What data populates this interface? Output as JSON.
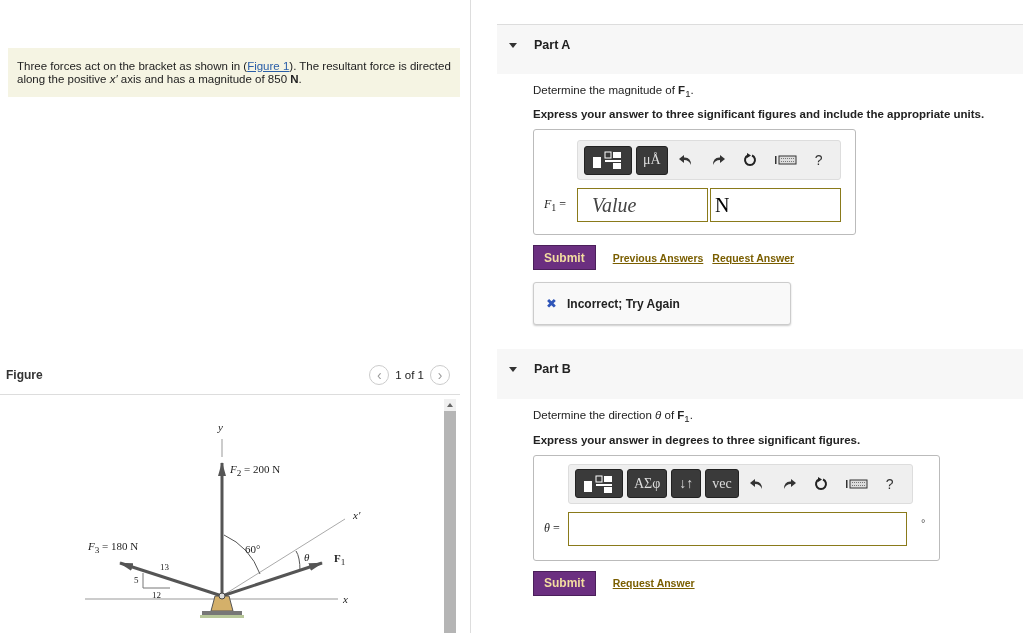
{
  "problem": {
    "before": "Three forces act on the bracket as shown in (",
    "link": "Figure 1",
    "after": "). The resultant force is directed along the positive *x′* axis and has a magnitude of 850 **N**."
  },
  "figure": {
    "title": "Figure",
    "pager": "1 of 1",
    "prev": "‹",
    "next": "›",
    "labels": [
      {
        "kind": "axis",
        "text": "*y*"
      },
      {
        "kind": "force",
        "text": "*F*$_{2}$ = 200 N"
      },
      {
        "kind": "axis",
        "text": "*x′*"
      },
      {
        "kind": "force",
        "text": "*F*$_{3}$ = 180 N"
      },
      {
        "kind": "angle",
        "text": "60°"
      },
      {
        "kind": "angle",
        "text": "*θ*"
      },
      {
        "kind": "force",
        "text": "**F**$_{1}$"
      },
      {
        "kind": "slope",
        "text": "13"
      },
      {
        "kind": "slope",
        "text": "5"
      },
      {
        "kind": "slope",
        "text": "12"
      },
      {
        "kind": "axis",
        "text": "*x*"
      }
    ]
  },
  "parts": [
    {
      "title": "Part A",
      "expanded": true,
      "prompt": "Determine the magnitude of **F**$_{1}$.",
      "instruction": "Express your answer to three significant figures and include the appropriate units.",
      "tools": [
        {
          "kind": "templates"
        },
        {
          "kind": "text",
          "text": "μÅ"
        },
        {
          "kind": "undo"
        },
        {
          "kind": "redo"
        },
        {
          "kind": "reset"
        },
        {
          "kind": "keyboard"
        },
        {
          "kind": "help",
          "text": "?"
        }
      ],
      "label": "*F*$_{1}$ =",
      "fields": [
        {
          "kind": "value",
          "placeholder": "Value"
        },
        {
          "kind": "unit",
          "value": "N"
        }
      ],
      "submit": "Submit",
      "links": [
        "Previous Answers",
        "Request Answer"
      ],
      "feedback": {
        "icon": "✖",
        "text": "Incorrect; Try Again"
      }
    },
    {
      "title": "Part B",
      "expanded": true,
      "prompt": "Determine the direction *θ* of **F**$_{1}$.",
      "instruction": "Express your answer in degrees to three significant figures.",
      "tools": [
        {
          "kind": "templates"
        },
        {
          "kind": "text",
          "text": "ΑΣφ"
        },
        {
          "kind": "text",
          "text": "↓↑"
        },
        {
          "kind": "text",
          "text": "vec"
        },
        {
          "kind": "undo"
        },
        {
          "kind": "redo"
        },
        {
          "kind": "reset"
        },
        {
          "kind": "keyboard"
        },
        {
          "kind": "help",
          "text": "?"
        }
      ],
      "label": "*θ* =",
      "fields": [
        {
          "kind": "wide"
        }
      ],
      "suffix": "°",
      "submit": "Submit",
      "links": [
        "Request Answer"
      ]
    }
  ]
}
